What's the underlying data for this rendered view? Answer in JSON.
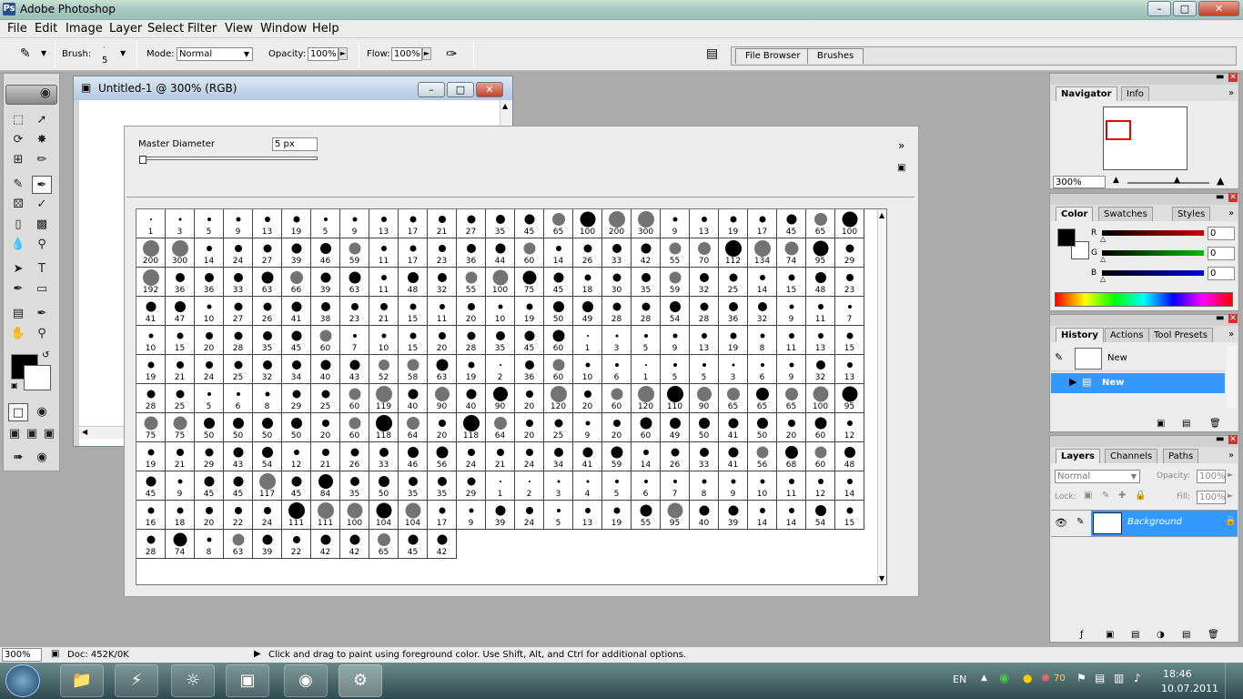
{
  "window": {
    "title": "Adobe Photoshop",
    "app_icon": "photoshop-icon",
    "controls": [
      "minimize",
      "maximize",
      "close"
    ]
  },
  "menu": [
    "File",
    "Edit",
    "Image",
    "Layer",
    "Select",
    "Filter",
    "View",
    "Window",
    "Help"
  ],
  "options": {
    "brush_label": "Brush:",
    "brush_size": "5",
    "mode_label": "Mode:",
    "mode_value": "Normal",
    "opacity_label": "Opacity:",
    "opacity_value": "100%",
    "flow_label": "Flow:",
    "flow_value": "100%"
  },
  "palette_well": {
    "tabs": [
      "File Browser",
      "Brushes"
    ]
  },
  "document": {
    "title": "Untitled-1 @ 300% (RGB)"
  },
  "brush_picker": {
    "master_diameter_label": "Master Diameter",
    "master_diameter_value": "5 px",
    "brush_sizes": [
      "1",
      "3",
      "5",
      "9",
      "13",
      "19",
      "5",
      "9",
      "13",
      "17",
      "21",
      "27",
      "35",
      "45",
      "65",
      "100",
      "200",
      "300",
      "9",
      "13",
      "19",
      "17",
      "45",
      "65",
      "100",
      "200",
      "300",
      "14",
      "24",
      "27",
      "39",
      "46",
      "59",
      "11",
      "17",
      "23",
      "36",
      "44",
      "60",
      "14",
      "26",
      "33",
      "42",
      "55",
      "70",
      "112",
      "134",
      "74",
      "95",
      "29",
      "192",
      "36",
      "36",
      "33",
      "63",
      "66",
      "39",
      "63",
      "11",
      "48",
      "32",
      "55",
      "100",
      "75",
      "45",
      "18",
      "30",
      "35",
      "59",
      "32",
      "25",
      "14",
      "15",
      "48",
      "23",
      "41",
      "47",
      "10",
      "27",
      "26",
      "41",
      "38",
      "23",
      "21",
      "15",
      "11",
      "20",
      "10",
      "19",
      "50",
      "49",
      "28",
      "28",
      "54",
      "28",
      "36",
      "32",
      "9",
      "11",
      "7",
      "10",
      "15",
      "20",
      "28",
      "35",
      "45",
      "60",
      "7",
      "10",
      "15",
      "20",
      "28",
      "35",
      "45",
      "60",
      "1",
      "3",
      "5",
      "9",
      "13",
      "19",
      "8",
      "11",
      "13",
      "15",
      "19",
      "21",
      "24",
      "25",
      "32",
      "34",
      "40",
      "43",
      "52",
      "58",
      "63",
      "19",
      "2",
      "36",
      "60",
      "10",
      "6",
      "1",
      "5",
      "5",
      "3",
      "6",
      "9",
      "32",
      "13",
      "28",
      "25",
      "5",
      "6",
      "8",
      "29",
      "25",
      "60",
      "119",
      "40",
      "90",
      "40",
      "90",
      "20",
      "120",
      "20",
      "60",
      "120",
      "110",
      "90",
      "65",
      "65",
      "65",
      "100",
      "95",
      "75",
      "75",
      "50",
      "50",
      "50",
      "50",
      "20",
      "60",
      "118",
      "64",
      "20",
      "118",
      "64",
      "20",
      "25",
      "9",
      "20",
      "60",
      "49",
      "50",
      "41",
      "50",
      "20",
      "60",
      "12",
      "19",
      "21",
      "29",
      "43",
      "54",
      "12",
      "21",
      "26",
      "33",
      "46",
      "56",
      "24",
      "21",
      "24",
      "34",
      "41",
      "59",
      "14",
      "26",
      "33",
      "41",
      "56",
      "68",
      "60",
      "48",
      "45",
      "9",
      "45",
      "45",
      "117",
      "45",
      "84",
      "35",
      "50",
      "35",
      "35",
      "29",
      "1",
      "2",
      "3",
      "4",
      "5",
      "6",
      "7",
      "8",
      "9",
      "10",
      "11",
      "12",
      "14",
      "16",
      "18",
      "20",
      "22",
      "24",
      "111",
      "111",
      "100",
      "104",
      "104",
      "17",
      "9",
      "39",
      "24",
      "5",
      "13",
      "19",
      "55",
      "95",
      "40",
      "39",
      "14",
      "14",
      "54",
      "15",
      "28",
      "74",
      "8",
      "63",
      "39",
      "22",
      "42",
      "42",
      "65",
      "45",
      "42"
    ]
  },
  "navigator": {
    "tabs": [
      "Navigator",
      "Info"
    ],
    "zoom": "300%"
  },
  "color": {
    "tabs": [
      "Color",
      "Swatches",
      "Styles"
    ],
    "channels": [
      {
        "name": "R",
        "value": "0",
        "color": "#cc0000"
      },
      {
        "name": "G",
        "value": "0",
        "color": "#00aa00"
      },
      {
        "name": "B",
        "value": "0",
        "color": "#0000cc"
      }
    ]
  },
  "history": {
    "tabs": [
      "History",
      "Actions",
      "Tool Presets"
    ],
    "items": [
      "New",
      "New"
    ]
  },
  "layers": {
    "tabs": [
      "Layers",
      "Channels",
      "Paths"
    ],
    "blend": "Normal",
    "opacity_label": "Opacity:",
    "opacity": "100%",
    "lock_label": "Lock:",
    "fill_label": "Fill:",
    "fill": "100%",
    "layer_name": "Background"
  },
  "status": {
    "zoom": "300%",
    "doc": "Doc: 452K/0K",
    "hint": "Click and drag to paint using foreground color.  Use Shift, Alt, and Ctrl for additional options."
  },
  "taskbar": {
    "lang": "EN",
    "time": "18:46",
    "date": "10.07.2011",
    "tray_number": "70"
  }
}
